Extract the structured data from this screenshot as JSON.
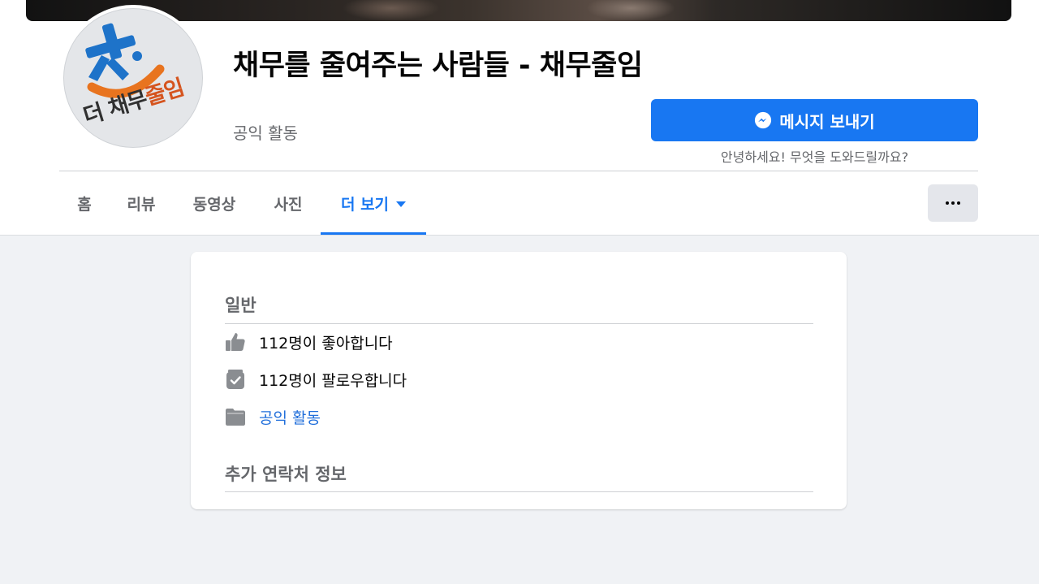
{
  "page": {
    "title": "채무를 줄여주는 사람들 - 채무줄임",
    "category": "공익 활동",
    "avatar_text_dark": "더 채무",
    "avatar_text_orange": "줄임"
  },
  "actions": {
    "message_label": "메시지 보내기",
    "message_hint": "안녕하세요! 무엇을 도와드릴까요?"
  },
  "tabs": [
    {
      "label": "홈"
    },
    {
      "label": "리뷰"
    },
    {
      "label": "동영상"
    },
    {
      "label": "사진"
    },
    {
      "label": "더 보기"
    }
  ],
  "about": {
    "general_heading": "일반",
    "likes": "112명이 좋아합니다",
    "follows": "112명이 팔로우합니다",
    "category_link": "공익 활동",
    "contact_heading": "추가 연락처 정보"
  },
  "icons": {
    "likes": "thumbs-up-icon",
    "follows": "follow-check-icon",
    "category": "folder-icon",
    "messenger": "messenger-icon"
  },
  "colors": {
    "primary": "#1877f2",
    "link": "#216fdb",
    "secondary_text": "#65676b",
    "background": "#f0f2f5",
    "logo_blue": "#1e73c9",
    "logo_orange": "#e8741f"
  }
}
